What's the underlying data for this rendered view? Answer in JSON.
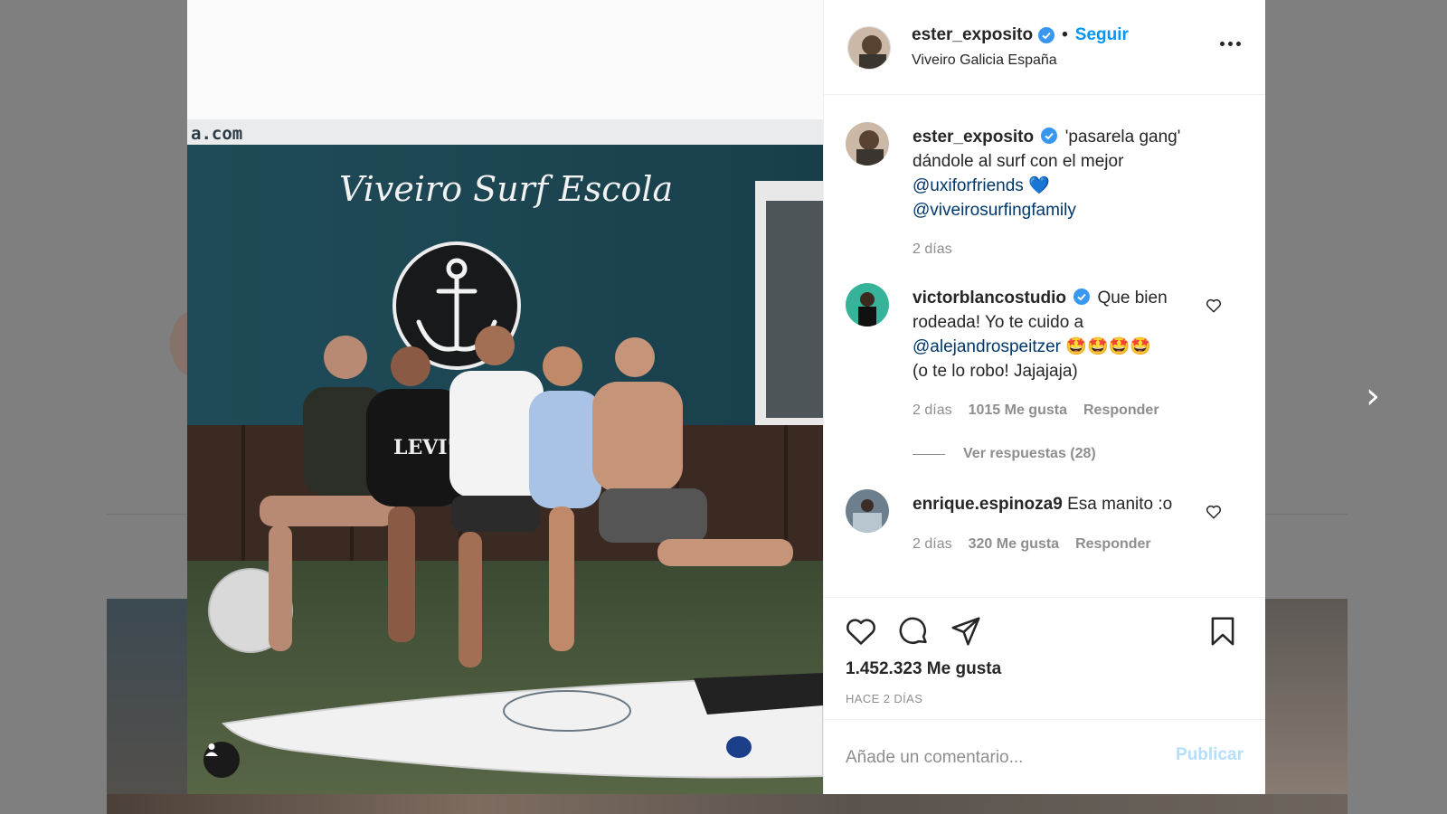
{
  "post": {
    "username": "ester_exposito",
    "follow_label": "Seguir",
    "separator": "•",
    "location": "Viveiro Galicia España",
    "photo_sign_text": "a.com",
    "photo_script_text": "Viveiro Surf Escola",
    "photo_shirt_text": "LEVI'S",
    "photo_sign_text_2": "a.com"
  },
  "caption": {
    "username": "ester_exposito",
    "text_1": "'pasarela gang' dándole al surf con el mejor ",
    "mention_1": "@uxiforfriends",
    "emoji": "💙",
    "mention_2": "@viveirosurfingfamily",
    "time": "2 días"
  },
  "comments": [
    {
      "username": "victorblancostudio",
      "text_1": "Que bien rodeada! Yo te cuido a ",
      "mention": "@alejandrospeitzer",
      "emojis": "🤩🤩🤩🤩",
      "text_2": "(o te lo robo! Jajajaja)",
      "time": "2 días",
      "likes": "1015 Me gusta",
      "reply_label": "Responder",
      "view_replies": "Ver respuestas (28)"
    },
    {
      "username": "enrique.espinoza9",
      "text_1": "Esa manito :o",
      "time": "2 días",
      "likes": "320 Me gusta",
      "reply_label": "Responder"
    }
  ],
  "stats": {
    "likes": "1.452.323 Me gusta",
    "posted": "HACE 2 DÍAS"
  },
  "comment_box": {
    "placeholder": "Añade un comentario...",
    "publish_label": "Publicar"
  },
  "colors": {
    "link_blue": "#0095f6",
    "verified_blue": "#3897f0",
    "publish_disabled": "#b2dffc",
    "muted": "#8e8e8e"
  },
  "icons": [
    "heart-icon",
    "comment-icon",
    "share-icon",
    "bookmark-icon",
    "more-icon",
    "verified-icon",
    "chevron-right-icon",
    "user-tag-icon"
  ]
}
